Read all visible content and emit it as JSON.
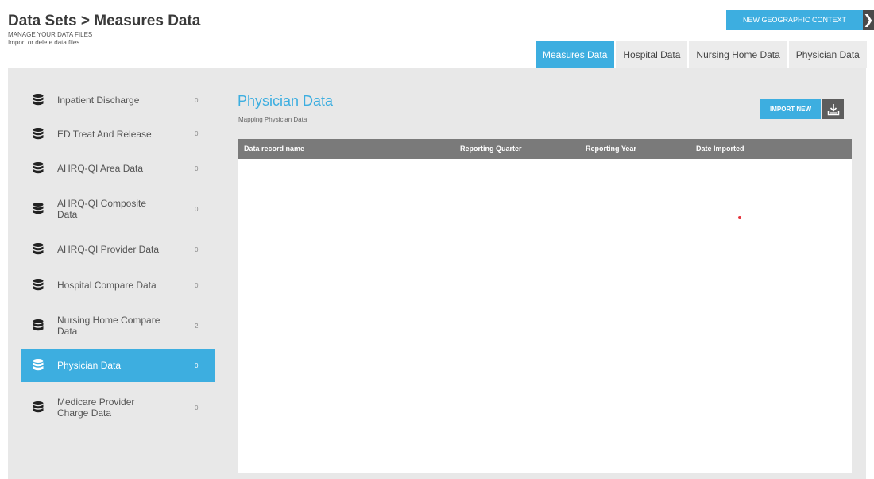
{
  "header": {
    "title": "Data Sets > Measures Data",
    "subtitle": "MANAGE YOUR DATA FILES",
    "description": "Import or delete data files.",
    "geo_button": "NEW GEOGRAPHIC CONTEXT"
  },
  "tabs": [
    {
      "label": "Measures Data",
      "active": true
    },
    {
      "label": "Hospital Data",
      "active": false
    },
    {
      "label": "Nursing Home Data",
      "active": false
    },
    {
      "label": "Physician Data",
      "active": false
    }
  ],
  "sidebar": {
    "items": [
      {
        "label": "Inpatient Discharge",
        "count": "0",
        "active": false
      },
      {
        "label": "ED Treat And Release",
        "count": "0",
        "active": false
      },
      {
        "label": "AHRQ-QI Area Data",
        "count": "0",
        "active": false
      },
      {
        "label": "AHRQ-QI Composite Data",
        "count": "0",
        "active": false
      },
      {
        "label": "AHRQ-QI Provider Data",
        "count": "0",
        "active": false
      },
      {
        "label": "Hospital Compare Data",
        "count": "0",
        "active": false
      },
      {
        "label": "Nursing Home Compare Data",
        "count": "2",
        "active": false
      },
      {
        "label": "Physician Data",
        "count": "0",
        "active": true
      },
      {
        "label": "Medicare Provider Charge Data",
        "count": "0",
        "active": false
      }
    ]
  },
  "main": {
    "title": "Physician Data",
    "subtitle": "Mapping Physician Data",
    "import_button": "IMPORT NEW",
    "columns": [
      "Data record name",
      "Reporting Quarter",
      "Reporting Year",
      "Date Imported"
    ],
    "rows": []
  },
  "colors": {
    "accent": "#3daee0",
    "dark": "#4a4a4a",
    "table_header": "#7a7a7a",
    "panel_bg": "#e8e8e8"
  }
}
